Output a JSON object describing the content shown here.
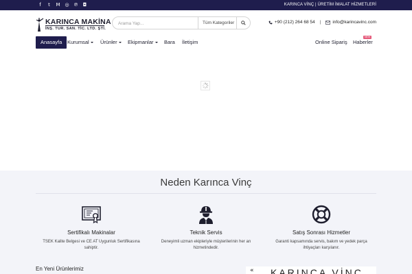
{
  "topbar": {
    "social_icons": [
      "facebook-icon",
      "twitter-icon",
      "yandex-icon",
      "instagram-icon",
      "pinterest-icon",
      "instagram-alt-icon"
    ],
    "social_glyphs": [
      "f",
      "t",
      "M",
      "◎",
      "℗",
      "◘"
    ],
    "tagline": "KARINCA VİNÇ | ÜRETİM İMALAT HİZMETLERİ"
  },
  "header": {
    "logo_name": "KARINCA MAKİNA",
    "logo_sub": "İNŞ. TUR. SAN. TİC. LTD. ŞTİ.",
    "search_placeholder": "Arama Yap...",
    "search_category": "Tüm Kategoriler",
    "phone": "+90 (212) 264 68 54",
    "separator": "|",
    "email": "info@karincavinc.com"
  },
  "nav": {
    "items": [
      {
        "label": "Anasayfa",
        "active": true,
        "dropdown": false
      },
      {
        "label": "Kurumsal",
        "active": false,
        "dropdown": true
      },
      {
        "label": "Ürünler",
        "active": false,
        "dropdown": true
      },
      {
        "label": "Ekipmanlar",
        "active": false,
        "dropdown": true
      },
      {
        "label": "Bara",
        "active": false,
        "dropdown": false
      },
      {
        "label": "İletişim",
        "active": false,
        "dropdown": false
      }
    ],
    "right": [
      {
        "label": "Online Sipariş"
      },
      {
        "label": "Haberler"
      }
    ],
    "badge": "NEW"
  },
  "why": {
    "title": "Neden Karınca Vinç",
    "features": [
      {
        "icon": "certificate-icon",
        "title": "Sertifikalı Makinalar",
        "desc": "TSEK Kalite Belgesi ve CE AT Uygunluk Sertifikasına sahiptir."
      },
      {
        "icon": "worker-icon",
        "title": "Teknik Servis",
        "desc": "Deneyimli uzman ekipleriyle müşterilerinin her an hizmetindedir."
      },
      {
        "icon": "lifebuoy-icon",
        "title": "Satış Sonrası Hizmetler",
        "desc": "Garanti kapsamında servis, bakım ve yedek parça ihtiyaçları karşılanır."
      }
    ]
  },
  "newest": {
    "title": "En Yeni Ürünlerimiz"
  },
  "banner": {
    "arrow": "«",
    "text": "KARINCA VİNÇ"
  },
  "colors": {
    "brand_navy": "#1f1d4d",
    "section_bg": "#f3f4f9",
    "badge": "#e55a7a"
  }
}
